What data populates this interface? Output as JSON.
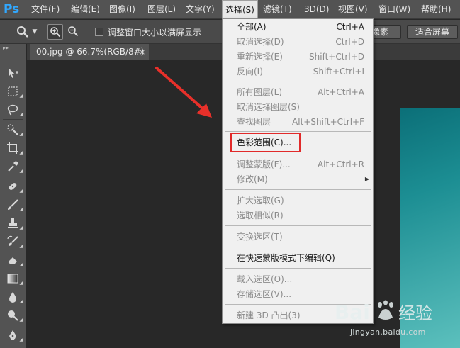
{
  "app": {
    "logo_text": "Ps"
  },
  "menubar": {
    "items": [
      {
        "label": "文件(F)"
      },
      {
        "label": "编辑(E)"
      },
      {
        "label": "图像(I)"
      },
      {
        "label": "图层(L)"
      },
      {
        "label": "文字(Y)"
      },
      {
        "label": "选择(S)",
        "active": true
      },
      {
        "label": "滤镜(T)"
      },
      {
        "label": "3D(D)"
      },
      {
        "label": "视图(V)"
      },
      {
        "label": "窗口(W)"
      },
      {
        "label": "帮助(H)"
      }
    ]
  },
  "options": {
    "resize_windows_label": "调整窗口大小以满屏显示",
    "pixel_button": "像素",
    "fit_screen_button": "适合屏幕"
  },
  "document": {
    "tab_title": "00.jpg @ 66.7%(RGB/8#)",
    "close_glyph": "×"
  },
  "select_menu": {
    "items": [
      {
        "label": "全部(A)",
        "shortcut": "Ctrl+A",
        "enabled": true
      },
      {
        "label": "取消选择(D)",
        "shortcut": "Ctrl+D",
        "enabled": false
      },
      {
        "label": "重新选择(E)",
        "shortcut": "Shift+Ctrl+D",
        "enabled": false
      },
      {
        "label": "反向(I)",
        "shortcut": "Shift+Ctrl+I",
        "enabled": false
      },
      {
        "label": "所有图层(L)",
        "shortcut": "Alt+Ctrl+A",
        "enabled": false
      },
      {
        "label": "取消选择图层(S)",
        "shortcut": "",
        "enabled": false
      },
      {
        "label": "查找图层",
        "shortcut": "Alt+Shift+Ctrl+F",
        "enabled": false
      },
      {
        "label": "色彩范围(C)...",
        "shortcut": "",
        "enabled": true,
        "highlighted": true
      },
      {
        "label": "调整蒙版(F)...",
        "shortcut": "Alt+Ctrl+R",
        "enabled": false
      },
      {
        "label": "修改(M)",
        "shortcut": "",
        "enabled": false,
        "submenu": true
      },
      {
        "label": "扩大选取(G)",
        "shortcut": "",
        "enabled": false
      },
      {
        "label": "选取相似(R)",
        "shortcut": "",
        "enabled": false
      },
      {
        "label": "变换选区(T)",
        "shortcut": "",
        "enabled": false
      },
      {
        "label": "在快速蒙版模式下编辑(Q)",
        "shortcut": "",
        "enabled": true
      },
      {
        "label": "载入选区(O)...",
        "shortcut": "",
        "enabled": false
      },
      {
        "label": "存储选区(V)...",
        "shortcut": "",
        "enabled": false
      },
      {
        "label": "新建 3D 凸出(3)",
        "shortcut": "",
        "enabled": false
      }
    ]
  },
  "watermark": {
    "logo_text": "Bai 经验",
    "url": "jingyan.baidu.com"
  },
  "colors": {
    "highlight_box": "#e12a2a",
    "arrow": "#e8302a",
    "accent": "#31a8ff"
  }
}
